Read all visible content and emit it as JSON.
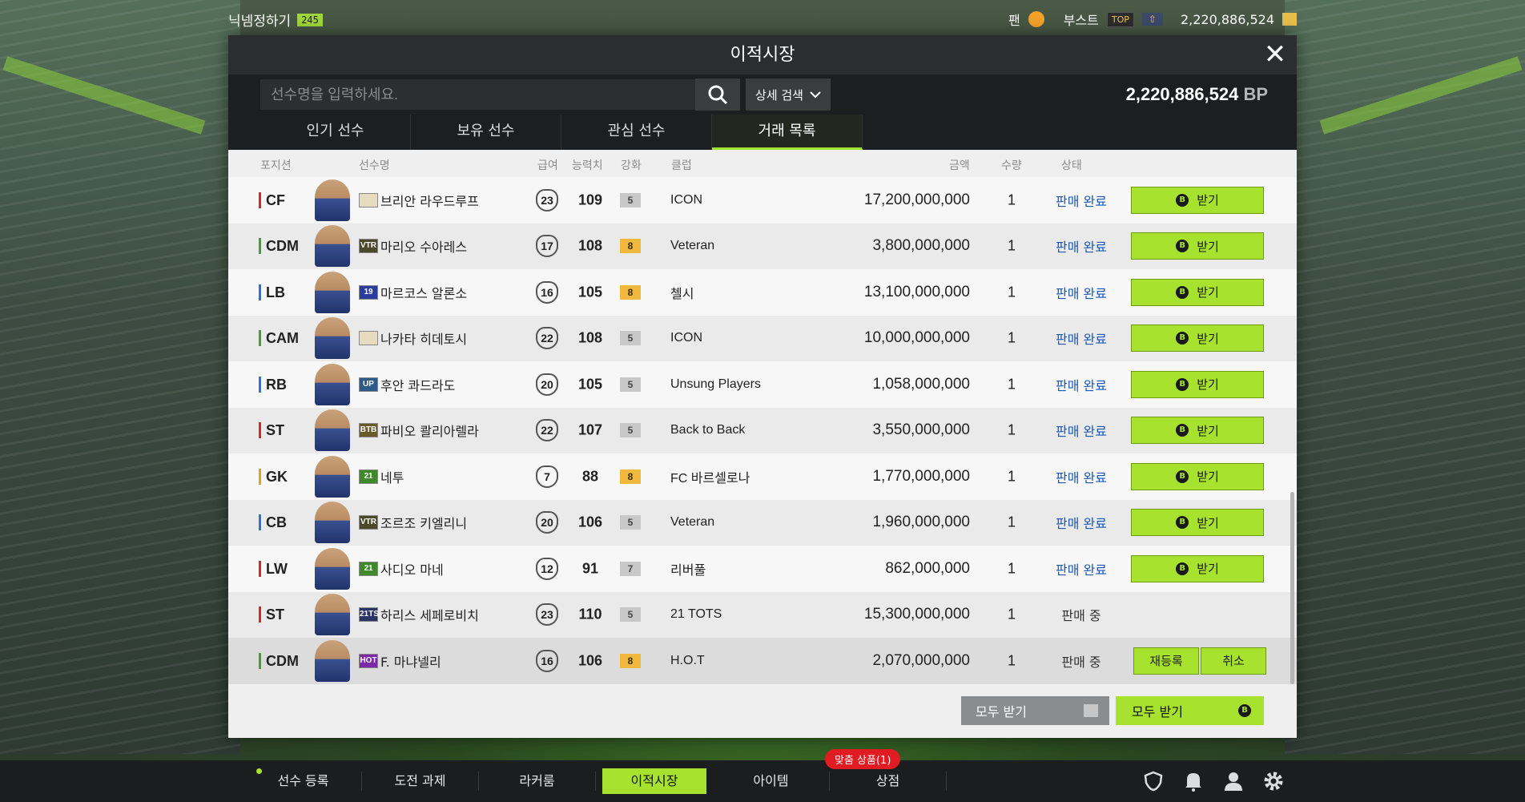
{
  "topbar": {
    "nickname": "닉넴정하기",
    "level": "245",
    "fan_label": "팬",
    "boost_label": "부스트",
    "top_tag": "TOP",
    "bp": "2,220,886,524"
  },
  "modal": {
    "title": "이적시장",
    "close": "✕",
    "search_placeholder": "선수명을 입력하세요.",
    "detail_search": "상세 검색",
    "bp_amount": "2,220,886,524",
    "bp_unit": "BP",
    "tabs": [
      "인기 선수",
      "보유 선수",
      "관심 선수",
      "거래 목록"
    ],
    "active_tab": "거래 목록",
    "columns": {
      "position": "포지션",
      "name": "선수명",
      "pay": "급여",
      "ovr": "능력치",
      "grade": "강화",
      "club": "클럽",
      "price": "금액",
      "qty": "수량",
      "status": "상태"
    },
    "rows": [
      {
        "pos": "CF",
        "season": "",
        "name": "브리안 라우드루프",
        "pay": "23",
        "ovr": "109",
        "grade": "5",
        "club": "ICON",
        "price": "17,200,000,000",
        "qty": "1",
        "status": "판매 완료"
      },
      {
        "pos": "CDM",
        "season": "VTR",
        "name": "마리오 수아레스",
        "pay": "17",
        "ovr": "108",
        "grade": "8",
        "club": "Veteran",
        "price": "3,800,000,000",
        "qty": "1",
        "status": "판매 완료"
      },
      {
        "pos": "LB",
        "season": "19",
        "name": "마르코스 알론소",
        "pay": "16",
        "ovr": "105",
        "grade": "8",
        "club": "첼시",
        "price": "13,100,000,000",
        "qty": "1",
        "status": "판매 완료"
      },
      {
        "pos": "CAM",
        "season": "",
        "name": "나카타 히데토시",
        "pay": "22",
        "ovr": "108",
        "grade": "5",
        "club": "ICON",
        "price": "10,000,000,000",
        "qty": "1",
        "status": "판매 완료"
      },
      {
        "pos": "RB",
        "season": "UP",
        "name": "후안 콰드라도",
        "pay": "20",
        "ovr": "105",
        "grade": "5",
        "club": "Unsung Players",
        "price": "1,058,000,000",
        "qty": "1",
        "status": "판매 완료"
      },
      {
        "pos": "ST",
        "season": "BTB",
        "name": "파비오 콸리아렐라",
        "pay": "22",
        "ovr": "107",
        "grade": "5",
        "club": "Back to Back",
        "price": "3,550,000,000",
        "qty": "1",
        "status": "판매 완료"
      },
      {
        "pos": "GK",
        "season": "21",
        "name": "네투",
        "pay": "7",
        "ovr": "88",
        "grade": "8",
        "club": "FC 바르셀로나",
        "price": "1,770,000,000",
        "qty": "1",
        "status": "판매 완료"
      },
      {
        "pos": "CB",
        "season": "VTR",
        "name": "조르조 키엘리니",
        "pay": "20",
        "ovr": "106",
        "grade": "5",
        "club": "Veteran",
        "price": "1,960,000,000",
        "qty": "1",
        "status": "판매 완료"
      },
      {
        "pos": "LW",
        "season": "21",
        "name": "사디오 마네",
        "pay": "12",
        "ovr": "91",
        "grade": "7",
        "club": "리버풀",
        "price": "862,000,000",
        "qty": "1",
        "status": "판매 완료"
      },
      {
        "pos": "ST",
        "season": "21TS",
        "name": "하리스 세페로비치",
        "pay": "23",
        "ovr": "110",
        "grade": "5",
        "club": "21 TOTS",
        "price": "15,300,000,000",
        "qty": "1",
        "status": "판매 중"
      },
      {
        "pos": "CDM",
        "season": "HOT",
        "name": "F. 마냐넬리",
        "pay": "16",
        "ovr": "106",
        "grade": "8",
        "club": "H.O.T",
        "price": "2,070,000,000",
        "qty": "1",
        "status": "판매 중"
      }
    ],
    "receive_label": "받기",
    "reregister_label": "재등록",
    "cancel_label": "취소",
    "receive_all_gray": "모두 받기",
    "receive_all_green": "모두 받기"
  },
  "bottom_nav": {
    "items": [
      "선수 등록",
      "도전 과제",
      "라커룸",
      "이적시장",
      "아이템",
      "상점"
    ],
    "active": "이적시장",
    "badge": "맞춤 상품(1)"
  },
  "colors": {
    "accent": "#a6e22e",
    "status_done": "#1e57b3",
    "forward": "#d0292d",
    "midfield": "#3fa13a",
    "defense": "#2b73d6",
    "keeper": "#e2a21b"
  }
}
